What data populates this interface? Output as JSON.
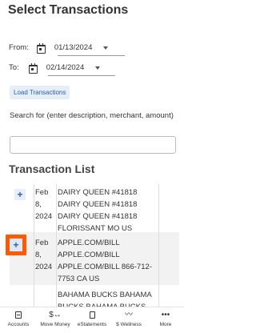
{
  "header": {
    "title": "Select Transactions"
  },
  "filters": {
    "from_label": "From:",
    "from_date": "01/13/2024",
    "to_label": "To:",
    "to_date": "02/14/2024",
    "load_button": "Load Transactions"
  },
  "search": {
    "label": "Search for (enter description, merchant, amount)",
    "value": "",
    "placeholder": ""
  },
  "list": {
    "title": "Transaction List",
    "rows": [
      {
        "date": [
          "Feb",
          "8,",
          "2024"
        ],
        "description": [
          "DAIRY QUEEN #41818",
          "DAIRY QUEEN #41818",
          "DAIRY QUEEN #41818",
          "FLORISSANT MO US"
        ]
      },
      {
        "date": [
          "Feb",
          "8,",
          "2024"
        ],
        "description": [
          "APPLE.COM/BILL",
          "APPLE.COM/BILL",
          "APPLE.COM/BILL 866-712-",
          "7753 CA US"
        ]
      },
      {
        "date": [],
        "description": [
          "BAHAMA BUCKS BAHAMA",
          "BUCKS BAHAMA BUCKS"
        ]
      }
    ],
    "add_symbol": "+"
  },
  "tabbar": {
    "items": [
      {
        "label": "Accounts",
        "icon": "accounts-icon"
      },
      {
        "label": "Move Money",
        "icon": "move-money-icon",
        "glyph": "$↔"
      },
      {
        "label": "eStatements",
        "icon": "document-icon"
      },
      {
        "label": "$ Wellness",
        "icon": "trend-icon",
        "glyph": "〰"
      },
      {
        "label": "More",
        "icon": "more-icon",
        "glyph": "•••"
      }
    ]
  },
  "colors": {
    "accent": "#2b5fab",
    "highlight": "#ff5a00"
  }
}
